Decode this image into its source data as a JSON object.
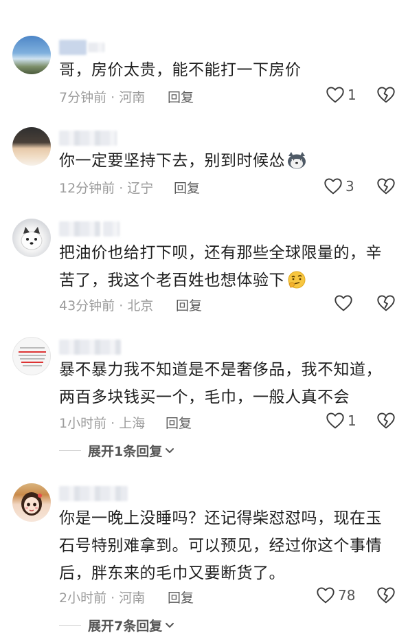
{
  "comments": [
    {
      "text": "哥，房价太贵，能不能打一下房价",
      "time_location": "7分钟前 · 河南",
      "reply_label": "回复",
      "likes": "1"
    },
    {
      "text": "你一定要坚持下去，别到时候怂",
      "time_location": "12分钟前 · 辽宁",
      "reply_label": "回复",
      "likes": "3"
    },
    {
      "text_line1": "把油价也给打下呗，还有那些全球限量的，辛",
      "text_line2": "苦了，我这个老百姓也想体验下",
      "time_location": "43分钟前 · 北京",
      "reply_label": "回复",
      "likes": ""
    },
    {
      "text_line1": "暴不暴力我不知道是不是奢侈品，我不知道，",
      "text_line2": "两百多块钱买一个，毛巾，一般人真不会",
      "time_location": "1小时前 · 上海",
      "reply_label": "回复",
      "likes": "1",
      "expand_label": "展开1条回复"
    },
    {
      "text_line1": "你是一晚上没睡吗？还记得柴怼怼吗，现在玉",
      "text_line2": "石号特别难拿到。可以预见，经过你这个事情",
      "text_line3": "后，胖东来的毛巾又要断货了。",
      "time_location": "2小时前 · 河南",
      "reply_label": "回复",
      "likes": "78",
      "expand_label": "展开7条回复"
    }
  ],
  "icons": {
    "like": "heart-outline-icon",
    "dislike": "broken-heart-icon",
    "expand": "chevron-down-icon"
  },
  "colors": {
    "text": "#1f1f1f",
    "meta": "#9b9b9b",
    "reply": "#5c5c5c"
  }
}
